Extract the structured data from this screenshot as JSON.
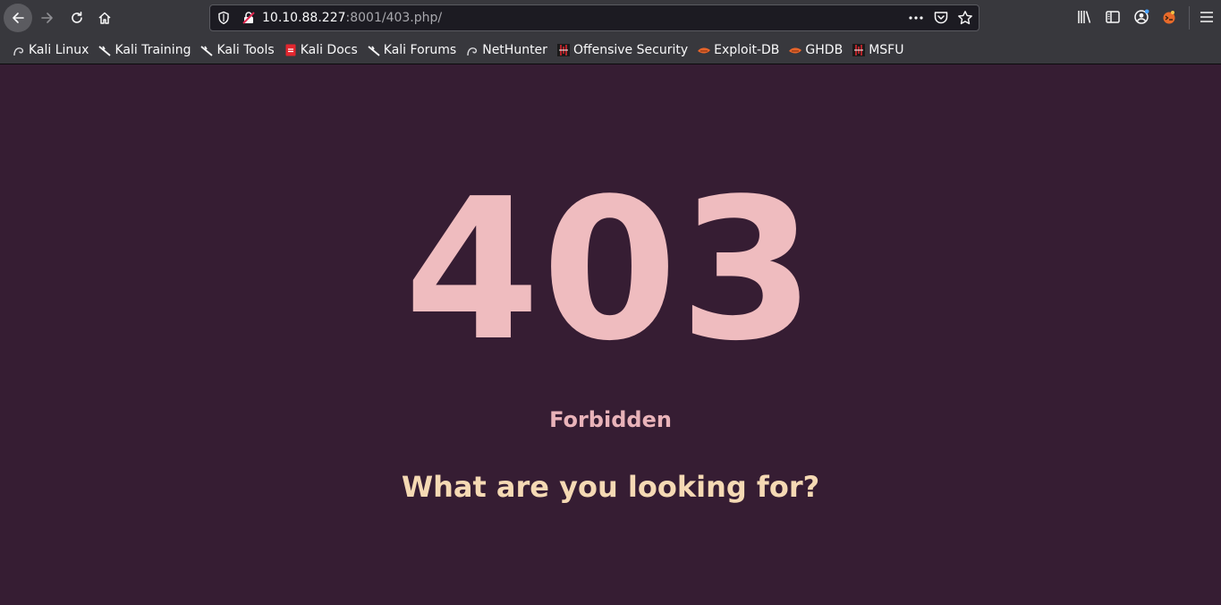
{
  "browser": {
    "url_host": "10.10.88.227",
    "url_rest": ":8001/403.php/",
    "bookmarks": [
      {
        "label": "Kali Linux",
        "icon": "kali-dragon-icon"
      },
      {
        "label": "Kali Training",
        "icon": "kali-dragon-icon"
      },
      {
        "label": "Kali Tools",
        "icon": "kali-dragon-icon"
      },
      {
        "label": "Kali Docs",
        "icon": "kali-docs-icon"
      },
      {
        "label": "Kali Forums",
        "icon": "kali-dragon-icon"
      },
      {
        "label": "NetHunter",
        "icon": "kali-dragon-icon"
      },
      {
        "label": "Offensive Security",
        "icon": "offsec-icon"
      },
      {
        "label": "Exploit-DB",
        "icon": "exploitdb-icon"
      },
      {
        "label": "GHDB",
        "icon": "exploitdb-icon"
      },
      {
        "label": "MSFU",
        "icon": "offsec-icon"
      }
    ]
  },
  "page": {
    "code": "403",
    "status": "Forbidden",
    "message": "What are you looking for?"
  },
  "colors": {
    "background": "#361d33",
    "code": "#efbcbf",
    "status": "#e9b3b9",
    "message": "#f5d9b4",
    "chrome": "#38383d"
  }
}
